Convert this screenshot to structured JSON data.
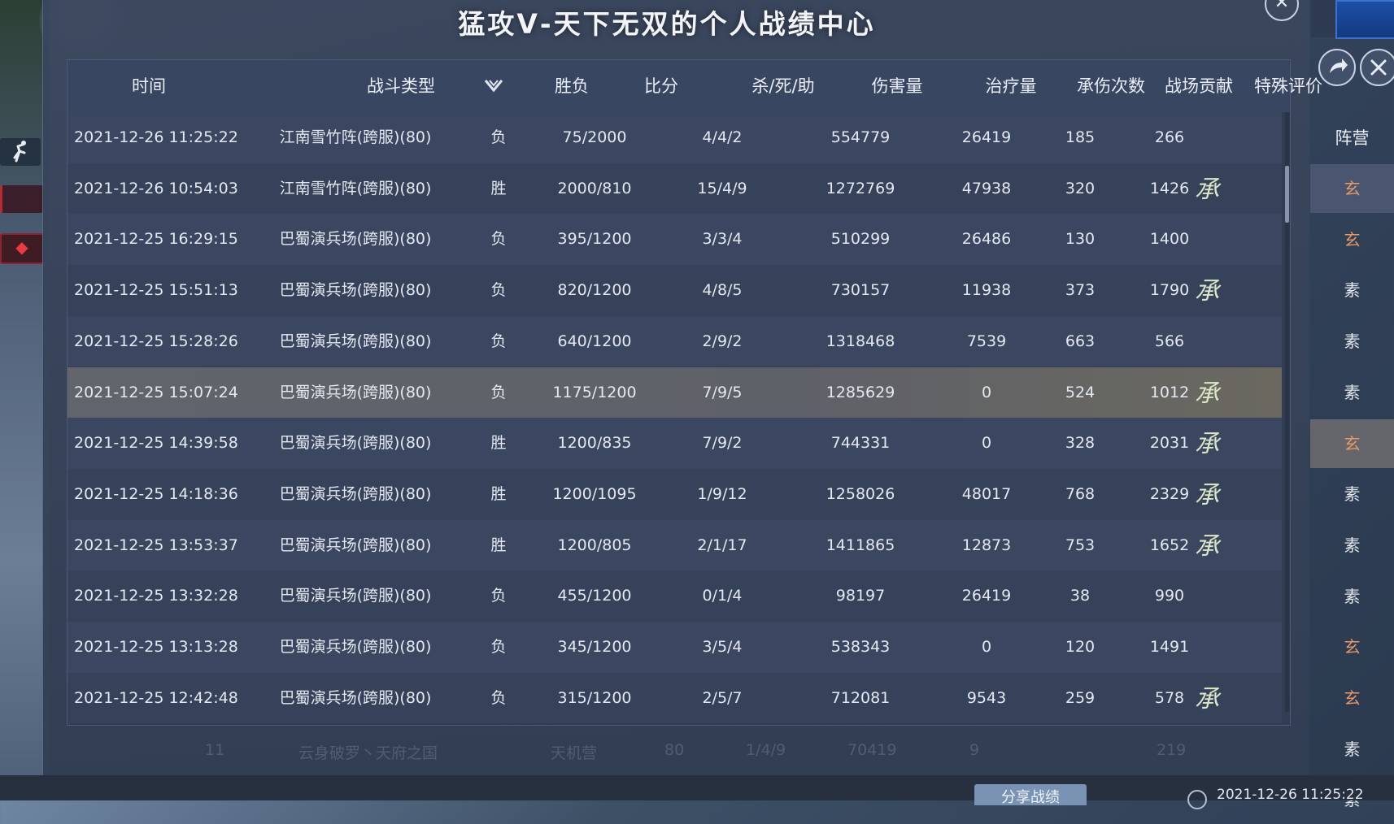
{
  "window": {
    "title": "猛攻ᐯ-天下无双的个人战绩中心"
  },
  "columns": {
    "time": "时间",
    "type": "战斗类型",
    "result": "胜负",
    "score": "比分",
    "kda": "杀/死/助",
    "damage": "伤害量",
    "healing": "治疗量",
    "hits_taken": "承伤次数",
    "contribution": "战场贡献",
    "special": "特殊评价",
    "camp": "阵营"
  },
  "rows": [
    {
      "time": "2021-12-26 11:25:22",
      "type": "江南雪竹阵(跨服)(80)",
      "result": "负",
      "score": "75/2000",
      "kda": "4/4/2",
      "damage": "554779",
      "healing": "26419",
      "hits": "185",
      "contrib": "266",
      "mark": "",
      "camp": "玄"
    },
    {
      "time": "2021-12-26 10:54:03",
      "type": "江南雪竹阵(跨服)(80)",
      "result": "胜",
      "score": "2000/810",
      "kda": "15/4/9",
      "damage": "1272769",
      "healing": "47938",
      "hits": "320",
      "contrib": "1426",
      "mark": "承",
      "camp": "玄"
    },
    {
      "time": "2021-12-25 16:29:15",
      "type": "巴蜀演兵场(跨服)(80)",
      "result": "负",
      "score": "395/1200",
      "kda": "3/3/4",
      "damage": "510299",
      "healing": "26486",
      "hits": "130",
      "contrib": "1400",
      "mark": "",
      "camp": "素"
    },
    {
      "time": "2021-12-25 15:51:13",
      "type": "巴蜀演兵场(跨服)(80)",
      "result": "负",
      "score": "820/1200",
      "kda": "4/8/5",
      "damage": "730157",
      "healing": "11938",
      "hits": "373",
      "contrib": "1790",
      "mark": "承",
      "camp": "素"
    },
    {
      "time": "2021-12-25 15:28:26",
      "type": "巴蜀演兵场(跨服)(80)",
      "result": "负",
      "score": "640/1200",
      "kda": "2/9/2",
      "damage": "1318468",
      "healing": "7539",
      "hits": "663",
      "contrib": "566",
      "mark": "",
      "camp": "素"
    },
    {
      "time": "2021-12-25 15:07:24",
      "type": "巴蜀演兵场(跨服)(80)",
      "result": "负",
      "score": "1175/1200",
      "kda": "7/9/5",
      "damage": "1285629",
      "healing": "0",
      "hits": "524",
      "contrib": "1012",
      "mark": "承",
      "camp": "玄"
    },
    {
      "time": "2021-12-25 14:39:58",
      "type": "巴蜀演兵场(跨服)(80)",
      "result": "胜",
      "score": "1200/835",
      "kda": "7/9/2",
      "damage": "744331",
      "healing": "0",
      "hits": "328",
      "contrib": "2031",
      "mark": "承",
      "camp": "素"
    },
    {
      "time": "2021-12-25 14:18:36",
      "type": "巴蜀演兵场(跨服)(80)",
      "result": "胜",
      "score": "1200/1095",
      "kda": "1/9/12",
      "damage": "1258026",
      "healing": "48017",
      "hits": "768",
      "contrib": "2329",
      "mark": "承",
      "camp": "素"
    },
    {
      "time": "2021-12-25 13:53:37",
      "type": "巴蜀演兵场(跨服)(80)",
      "result": "胜",
      "score": "1200/805",
      "kda": "2/1/17",
      "damage": "1411865",
      "healing": "12873",
      "hits": "753",
      "contrib": "1652",
      "mark": "承",
      "camp": "素"
    },
    {
      "time": "2021-12-25 13:32:28",
      "type": "巴蜀演兵场(跨服)(80)",
      "result": "负",
      "score": "455/1200",
      "kda": "0/1/4",
      "damage": "98197",
      "healing": "26419",
      "hits": "38",
      "contrib": "990",
      "mark": "",
      "camp": "玄"
    },
    {
      "time": "2021-12-25 13:13:28",
      "type": "巴蜀演兵场(跨服)(80)",
      "result": "负",
      "score": "345/1200",
      "kda": "3/5/4",
      "damage": "538343",
      "healing": "0",
      "hits": "120",
      "contrib": "1491",
      "mark": "",
      "camp": "玄"
    },
    {
      "time": "2021-12-25 12:42:48",
      "type": "巴蜀演兵场(跨服)(80)",
      "result": "负",
      "score": "315/1200",
      "kda": "2/5/7",
      "damage": "712081",
      "healing": "9543",
      "hits": "259",
      "contrib": "578",
      "mark": "承",
      "camp": "素"
    }
  ],
  "extra_camp": [
    "素"
  ],
  "selected_row": 5,
  "ghost_row": {
    "a": "11",
    "b": "云身破罗丶天府之国",
    "c": "天机营",
    "d": "80",
    "e": "1/4/9",
    "f": "70419",
    "g": "9",
    "h": "219"
  },
  "bottom": {
    "share_label": "分享战绩",
    "clock_text": "2021-12-26 11:25:22"
  },
  "colors": {
    "xuan": "#e89a6a",
    "su": "#e4e8f0",
    "highlight": "#64656b"
  }
}
